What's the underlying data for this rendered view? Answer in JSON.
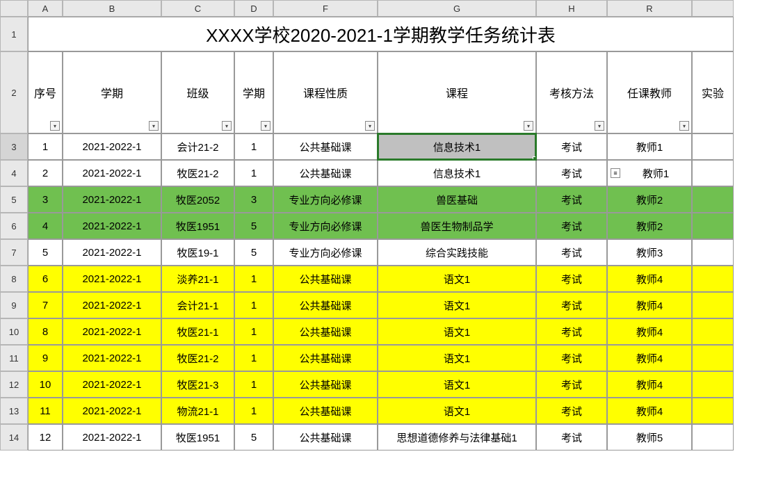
{
  "columns": [
    "A",
    "B",
    "C",
    "D",
    "F",
    "G",
    "H",
    "R",
    ""
  ],
  "row_labels": [
    "1",
    "2",
    "3",
    "4",
    "5",
    "6",
    "7",
    "8",
    "9",
    "10",
    "11",
    "12",
    "13",
    "14"
  ],
  "title": "XXXX学校2020-2021-1学期教学任务统计表",
  "headers": [
    "序号",
    "学期",
    "班级",
    "学期",
    "课程性质",
    "课程",
    "考核方法",
    "任课教师",
    "实验"
  ],
  "chart_data": {
    "type": "table",
    "columns": [
      "序号",
      "学期",
      "班级",
      "学期",
      "课程性质",
      "课程",
      "考核方法",
      "任课教师"
    ],
    "rows": [
      {
        "n": "1",
        "term": "2021-2022-1",
        "class": "会计21-2",
        "sem": "1",
        "nature": "公共基础课",
        "course": "信息技术1",
        "exam": "考试",
        "teacher": "教师1",
        "hl": "sel"
      },
      {
        "n": "2",
        "term": "2021-2022-1",
        "class": "牧医21-2",
        "sem": "1",
        "nature": "公共基础课",
        "course": "信息技术1",
        "exam": "考试",
        "teacher": "教师1",
        "hl": "note"
      },
      {
        "n": "3",
        "term": "2021-2022-1",
        "class": "牧医2052",
        "sem": "3",
        "nature": "专业方向必修课",
        "course": "兽医基础",
        "exam": "考试",
        "teacher": "教师2",
        "hl": "green"
      },
      {
        "n": "4",
        "term": "2021-2022-1",
        "class": "牧医1951",
        "sem": "5",
        "nature": "专业方向必修课",
        "course": "兽医生物制品学",
        "exam": "考试",
        "teacher": "教师2",
        "hl": "green"
      },
      {
        "n": "5",
        "term": "2021-2022-1",
        "class": "牧医19-1",
        "sem": "5",
        "nature": "专业方向必修课",
        "course": "综合实践技能",
        "exam": "考试",
        "teacher": "教师3",
        "hl": ""
      },
      {
        "n": "6",
        "term": "2021-2022-1",
        "class": "淡养21-1",
        "sem": "1",
        "nature": "公共基础课",
        "course": "语文1",
        "exam": "考试",
        "teacher": "教师4",
        "hl": "yellow"
      },
      {
        "n": "7",
        "term": "2021-2022-1",
        "class": "会计21-1",
        "sem": "1",
        "nature": "公共基础课",
        "course": "语文1",
        "exam": "考试",
        "teacher": "教师4",
        "hl": "yellow"
      },
      {
        "n": "8",
        "term": "2021-2022-1",
        "class": "牧医21-1",
        "sem": "1",
        "nature": "公共基础课",
        "course": "语文1",
        "exam": "考试",
        "teacher": "教师4",
        "hl": "yellow"
      },
      {
        "n": "9",
        "term": "2021-2022-1",
        "class": "牧医21-2",
        "sem": "1",
        "nature": "公共基础课",
        "course": "语文1",
        "exam": "考试",
        "teacher": "教师4",
        "hl": "yellow"
      },
      {
        "n": "10",
        "term": "2021-2022-1",
        "class": "牧医21-3",
        "sem": "1",
        "nature": "公共基础课",
        "course": "语文1",
        "exam": "考试",
        "teacher": "教师4",
        "hl": "yellow"
      },
      {
        "n": "11",
        "term": "2021-2022-1",
        "class": "物流21-1",
        "sem": "1",
        "nature": "公共基础课",
        "course": "语文1",
        "exam": "考试",
        "teacher": "教师4",
        "hl": "yellow"
      },
      {
        "n": "12",
        "term": "2021-2022-1",
        "class": "牧医1951",
        "sem": "5",
        "nature": "公共基础课",
        "course": "思想道德修养与法律基础1",
        "exam": "考试",
        "teacher": "教师5",
        "hl": ""
      }
    ]
  }
}
